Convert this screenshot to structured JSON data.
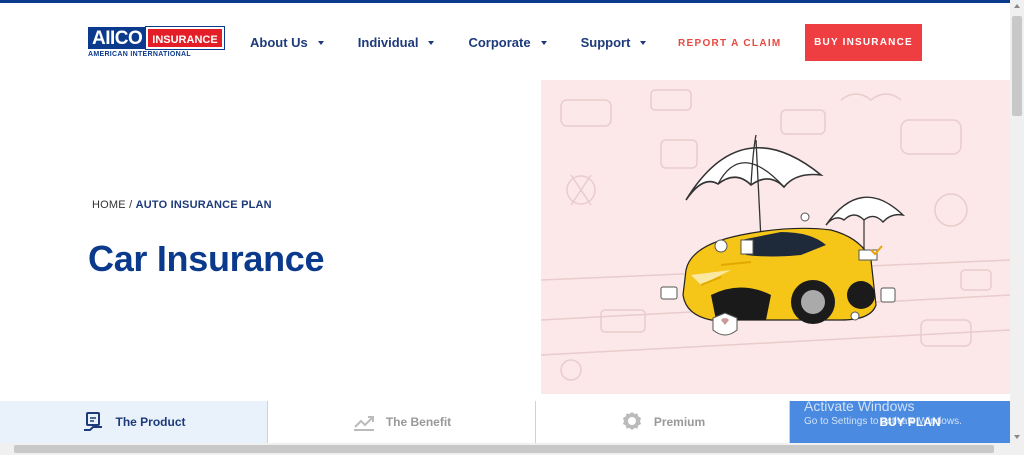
{
  "header": {
    "logo": {
      "main": "AIICO",
      "badge": "INSURANCE",
      "subtitle": "AMERICAN INTERNATIONAL"
    },
    "nav": [
      {
        "label": "About Us"
      },
      {
        "label": "Individual"
      },
      {
        "label": "Corporate"
      },
      {
        "label": "Support"
      }
    ],
    "report_label": "REPORT A CLAIM",
    "buy_label": "BUY INSURANCE"
  },
  "breadcrumb": {
    "home": "HOME",
    "separator": "/",
    "current": "AUTO INSURANCE PLAN"
  },
  "page_title": "Car Insurance",
  "tabs": [
    {
      "label": "The Product",
      "icon": "product-icon"
    },
    {
      "label": "The Benefit",
      "icon": "chart-icon"
    },
    {
      "label": "Premium",
      "icon": "badge-icon"
    },
    {
      "label": "BUY PLAN"
    }
  ],
  "watermark": {
    "line1": "Activate Windows",
    "line2": "Go to Settings to activate Windows."
  },
  "colors": {
    "brand_blue": "#0b3a8c",
    "accent_red": "#ef3e42",
    "hero_bg": "#fce8e8",
    "buy_tab": "#4a8ae0"
  }
}
